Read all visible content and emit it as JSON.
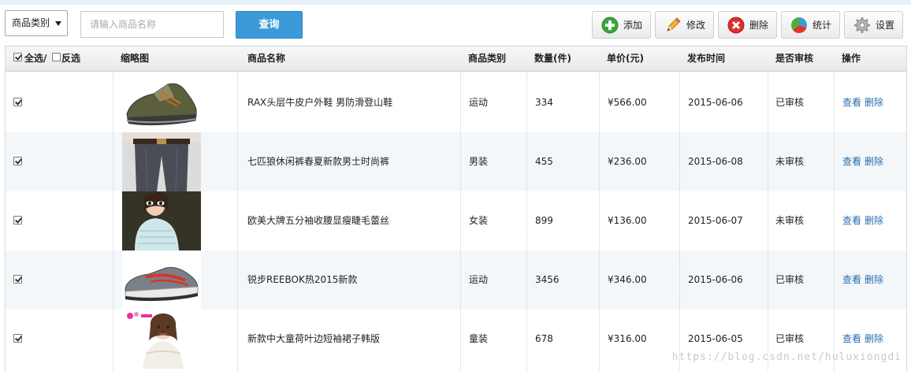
{
  "toolbar": {
    "category_select": "商品类别",
    "search_placeholder": "请输入商品名称",
    "query_label": "查询",
    "add_label": "添加",
    "edit_label": "修改",
    "delete_label": "删除",
    "stats_label": "统计",
    "settings_label": "设置"
  },
  "table": {
    "headers": {
      "select_all": "全选/",
      "invert": "反选",
      "thumb": "缩略图",
      "name": "商品名称",
      "category": "商品类别",
      "qty": "数量(件)",
      "price": "单价(元)",
      "date": "发布时间",
      "audit": "是否审核",
      "ops": "操作"
    },
    "view_label": "查看",
    "delete_label": "删除",
    "rows": [
      {
        "name": "RAX头层牛皮户外鞋 男防滑登山鞋",
        "category": "运动",
        "qty": "334",
        "price": "¥566.00",
        "date": "2015-06-06",
        "audit": "已审核",
        "thumb": "hiking-shoe"
      },
      {
        "name": "七匹狼休闲裤春夏新款男士时尚裤",
        "category": "男装",
        "qty": "455",
        "price": "¥236.00",
        "date": "2015-06-08",
        "audit": "未审核",
        "thumb": "trousers"
      },
      {
        "name": "欧美大牌五分袖收腰显瘦睫毛蕾丝",
        "category": "女装",
        "qty": "899",
        "price": "¥136.00",
        "date": "2015-06-07",
        "audit": "未审核",
        "thumb": "lace-top"
      },
      {
        "name": "锐步REEBOK热2015新款",
        "category": "运动",
        "qty": "3456",
        "price": "¥346.00",
        "date": "2015-06-06",
        "audit": "已审核",
        "thumb": "sneaker"
      },
      {
        "name": "新款中大童荷叶边短袖裙子韩版",
        "category": "童装",
        "qty": "678",
        "price": "¥316.00",
        "date": "2015-06-05",
        "audit": "已审核",
        "thumb": "kids-dress"
      }
    ]
  },
  "watermark": "https://blog.csdn.net/huluxiongdi",
  "colors": {
    "accent": "#3d9ad8",
    "link": "#2b6cb0",
    "alt_row": "#f3f7fa"
  }
}
